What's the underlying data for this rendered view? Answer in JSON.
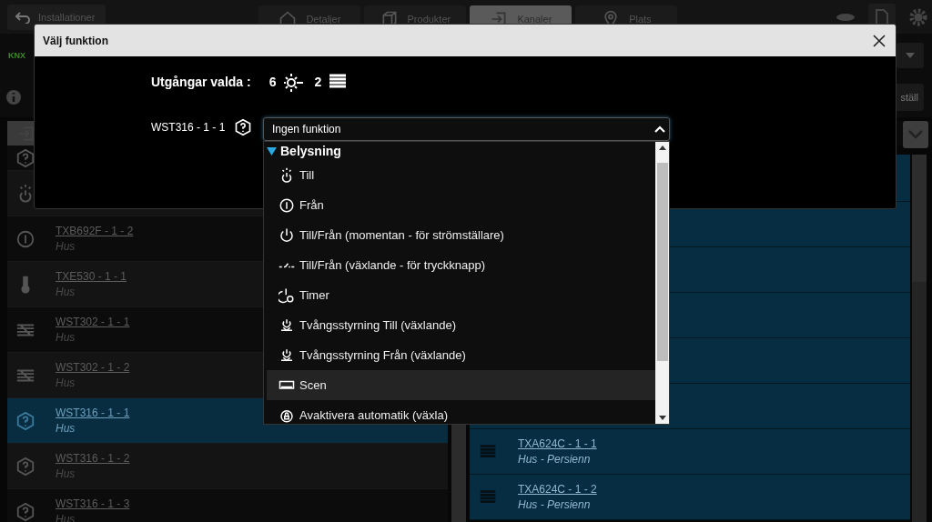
{
  "top_bar": {
    "back_button": "Installationer",
    "tabs": [
      {
        "label": "Detaljer",
        "kind": "house",
        "selected": false
      },
      {
        "label": "Produkter",
        "kind": "box",
        "selected": false
      },
      {
        "label": "Kanaler",
        "kind": "exit",
        "selected": true
      },
      {
        "label": "Plats",
        "kind": "pin",
        "selected": false
      }
    ]
  },
  "logo": "KNX",
  "action_button": "ställ",
  "left_list": [
    {
      "kind": "question",
      "selected": false
    },
    {
      "kind": "till",
      "selected": false
    },
    {
      "name": "TXB692F - 1 - 2",
      "location": "Hus",
      "kind": "fran",
      "selected": false
    },
    {
      "name": "TXE530 - 1 - 1",
      "location": "Hus",
      "kind": "thermo",
      "selected": false
    },
    {
      "name": "WST302 - 1 - 1",
      "location": "Hus",
      "kind": "stripes",
      "selected": false
    },
    {
      "name": "WST302 - 1 - 2",
      "location": "Hus",
      "kind": "stripes",
      "selected": false
    },
    {
      "name": "WST316 - 1 - 1",
      "location": "Hus",
      "kind": "question",
      "selected": true
    },
    {
      "name": "WST316 - 1 - 2",
      "location": "Hus",
      "kind": "question",
      "selected": false
    },
    {
      "name": "WST316 - 1 - 3",
      "location": "Hus",
      "kind": "question",
      "selected": false
    }
  ],
  "right_list": [
    {
      "selected": true
    },
    {
      "selected": true
    },
    {
      "selected": true
    },
    {
      "selected": true
    },
    {
      "selected": true
    },
    {
      "selected": true
    },
    {
      "name": "TXA624C - 1 - 1",
      "location": "Hus - Persienn",
      "kind": "blinds",
      "selected": true
    },
    {
      "name": "TXA624C - 1 - 2",
      "location": "Hus - Persienn",
      "kind": "blinds",
      "selected": true
    }
  ],
  "dialog": {
    "title": "Välj funktion",
    "outputs_label": "Utgångar valda :",
    "outputs": [
      {
        "count": "6",
        "kind": "light"
      },
      {
        "count": "2",
        "kind": "blinds"
      }
    ],
    "channel": "WST316 - 1 - 1",
    "select": {
      "value": "Ingen funktion",
      "expanded": true
    },
    "group": {
      "label": "Belysning",
      "expanded": true
    },
    "options": [
      {
        "label": "Till",
        "kind": "till",
        "selected": false
      },
      {
        "label": "Från",
        "kind": "fran",
        "selected": false
      },
      {
        "label": "Till/Från (momentan - för strömställare)",
        "kind": "power",
        "selected": false
      },
      {
        "label": "Till/Från (växlande - för tryckknapp)",
        "kind": "toggle",
        "selected": false
      },
      {
        "label": "Timer",
        "kind": "timer",
        "selected": false
      },
      {
        "label": "Tvångsstyrning Till (växlande)",
        "kind": "force",
        "selected": false
      },
      {
        "label": "Tvångsstyrning Från (växlande)",
        "kind": "force",
        "selected": false
      },
      {
        "label": "Scen",
        "kind": "scene",
        "selected": true
      },
      {
        "label": "Avaktivera automatik (växla)",
        "kind": "auto",
        "selected": false
      }
    ]
  }
}
